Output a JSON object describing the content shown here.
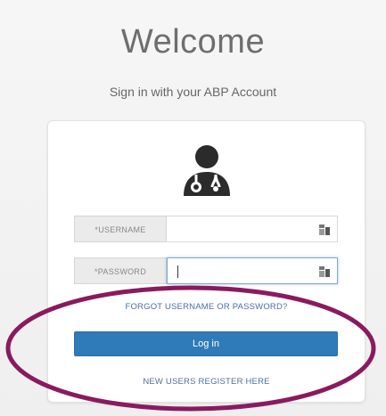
{
  "header": {
    "title": "Welcome",
    "subtitle": "Sign in with your ABP Account"
  },
  "form": {
    "username_label": "*USERNAME",
    "username_value": "",
    "password_label": "*PASSWORD",
    "password_value": "",
    "forgot_link": "FORGOT USERNAME OR PASSWORD?",
    "login_button": "Log in",
    "register_link": "NEW USERS REGISTER HERE"
  },
  "icons": {
    "avatar": "doctor-avatar-icon",
    "credential": "password-manager-key-icon"
  },
  "colors": {
    "background": "#f4f4f4",
    "card": "#ffffff",
    "title_text": "#6e6e6e",
    "link": "#4a6fa5",
    "button": "#2f7ab8",
    "highlight_ellipse": "#8a1a5e"
  }
}
